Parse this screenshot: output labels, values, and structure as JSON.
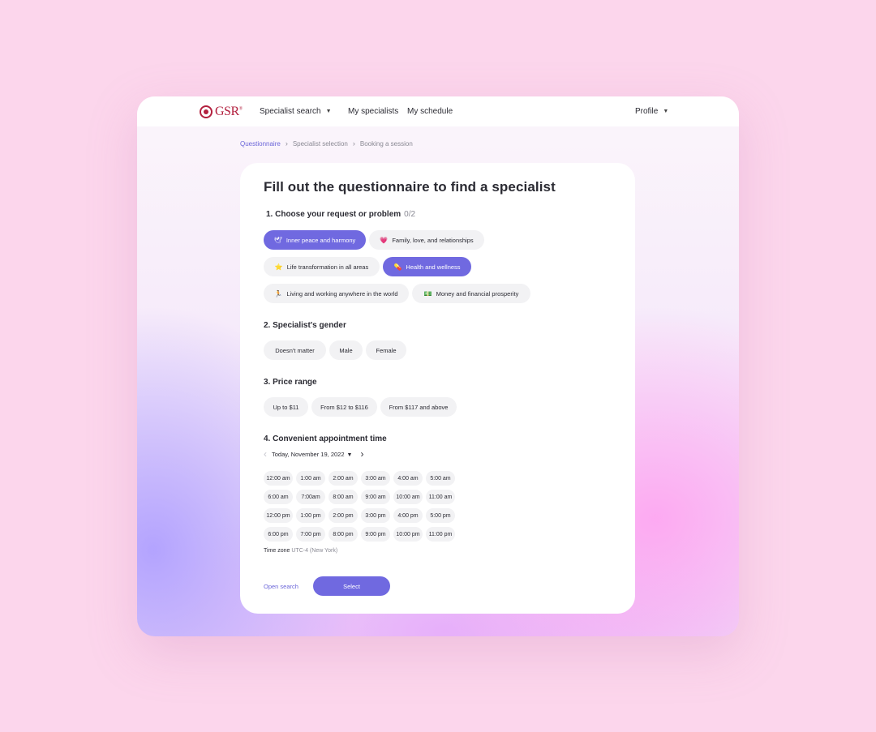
{
  "brand": {
    "logo_text": "GSR",
    "logo_reg": "®"
  },
  "nav": {
    "specialist_search": "Specialist search",
    "my_specialists": "My specialists",
    "my_schedule": "My schedule",
    "profile": "Profile"
  },
  "breadcrumb": [
    "Questionnaire",
    "Specialist selection",
    "Booking a session"
  ],
  "page_title": "Fill out the questionnaire to find a specialist",
  "q1": {
    "title": "1. Choose your request or problem",
    "counter": "0/2",
    "options": [
      {
        "emoji": "🕊",
        "label": "Inner peace and harmony",
        "selected": true
      },
      {
        "emoji": "💗",
        "label": "Family, love, and relationships",
        "selected": false
      },
      {
        "emoji": "⭐",
        "label": "Life transformation in all areas",
        "selected": false
      },
      {
        "emoji": "💊",
        "label": "Health and wellness",
        "selected": true
      },
      {
        "emoji": "🏃",
        "label": "Living and working anywhere in the world",
        "selected": false
      },
      {
        "emoji": "💵",
        "label": "Money and financial prosperity",
        "selected": false
      }
    ]
  },
  "q2": {
    "title": "2. Specialist's gender",
    "options": [
      "Doesn't matter",
      "Male",
      "Female"
    ]
  },
  "q3": {
    "title": "3. Price range",
    "options": [
      "Up to $11",
      "From $12 to $116",
      "From $117 and above"
    ]
  },
  "q4": {
    "title": "4. Convenient appointment time",
    "date": "Today, November 19, 2022",
    "slots": [
      [
        "12:00 am",
        "1:00 am",
        "2:00 am",
        "3:00 am",
        "4:00 am",
        "5:00 am"
      ],
      [
        "6:00 am",
        "7:00am",
        "8:00 am",
        "9:00 am",
        "10:00 am",
        "11:00 am"
      ],
      [
        "12:00 pm",
        "1:00 pm",
        "2:00 pm",
        "3:00 pm",
        "4:00 pm",
        "5:00 pm"
      ],
      [
        "6:00 pm",
        "7:00 pm",
        "8:00 pm",
        "9:00 pm",
        "10:00 pm",
        "11:00 pm"
      ]
    ],
    "timezone_label": "Time zone",
    "timezone_value": "UTC-4 (New York)"
  },
  "actions": {
    "open_search": "Open search",
    "select": "Select"
  },
  "colors": {
    "accent": "#7069e0",
    "brand": "#b3213f",
    "background": "#fcd6ec"
  }
}
